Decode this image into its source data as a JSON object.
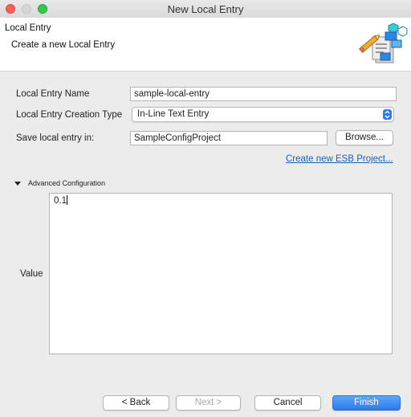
{
  "window": {
    "title": "New Local Entry"
  },
  "banner": {
    "title": "Local Entry",
    "description": "Create a new Local Entry",
    "icon": "wizard-banner-icon"
  },
  "form": {
    "name_label": "Local Entry Name",
    "name_value": "sample-local-entry",
    "type_label": "Local Entry Creation Type",
    "type_value": "In-Line Text Entry",
    "save_label": "Save local entry in:",
    "save_value": "SampleConfigProject",
    "browse_label": "Browse...",
    "create_project_link": "Create new ESB Project..."
  },
  "advanced": {
    "section_label": "Advanced Configuration",
    "expanded": true,
    "value_label": "Value",
    "value_text": "0.1"
  },
  "buttons": {
    "back": "< Back",
    "next": "Next >",
    "cancel": "Cancel",
    "finish": "Finish"
  },
  "colors": {
    "accent": "#2b79f0",
    "link": "#1a5fc2",
    "close": "#fc605c",
    "maximize": "#34c84a"
  }
}
